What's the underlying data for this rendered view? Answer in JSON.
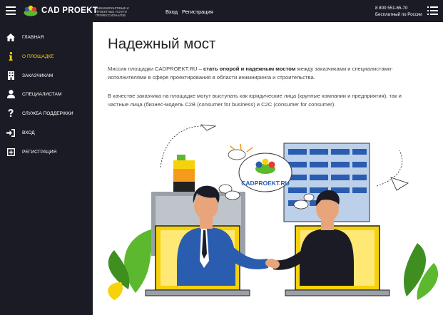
{
  "header": {
    "logo_text": "CAD PROEKT",
    "logo_subtitle": "ИНЖИНИРИНГОВЫЕ И ПРОЕКТНЫЕ УСЛУГИ ПРОФЕССИОНАЛОВ",
    "login_label": "Вход",
    "register_label": "Регистрация",
    "phone": "8 800 551-65-70",
    "phone_note": "Бесплатный по России"
  },
  "sidebar": {
    "items": [
      {
        "label": "ГЛАВНАЯ",
        "icon": "home-icon",
        "active": false
      },
      {
        "label": "О ПЛОЩАДКЕ",
        "icon": "info-icon",
        "active": true
      },
      {
        "label": "ЗАКАЗЧИКАМ",
        "icon": "building-icon",
        "active": false
      },
      {
        "label": "СПЕЦИАЛИСТАМ",
        "icon": "user-icon",
        "active": false
      },
      {
        "label": "СЛУЖБА ПОДДЕРЖКИ",
        "icon": "question-icon",
        "active": false
      },
      {
        "label": "ВХОД",
        "icon": "sign-in-icon",
        "active": false
      },
      {
        "label": "РЕГИСТРАЦИЯ",
        "icon": "plus-square-icon",
        "active": false
      }
    ]
  },
  "main": {
    "title": "Надежный мост",
    "para1_prefix": "Миссия площадки CADPROEKT.RU – ",
    "para1_bold": "стать опорой и надежным мостом",
    "para1_line1_suffix": " между заказчиками и специалистами-",
    "para1_line2": "исполнителями в сфере проектирования в области инжиниринга и строительства.",
    "para2_line1": "В качестве заказчика на площадке могут выступать как юридические лица (крупные компании и предприятия), так и",
    "para2_line2": "частные лица (бизнес-модель C2B (consumer for business) и C2C (consumer for consumer).",
    "illustration_badge": "CADPROEKT.RU"
  },
  "colors": {
    "accent": "#f5d20a",
    "sidebar_bg": "#1b1b25",
    "brand_blue": "#2a5db0",
    "leaf_green": "#5cb82e"
  }
}
